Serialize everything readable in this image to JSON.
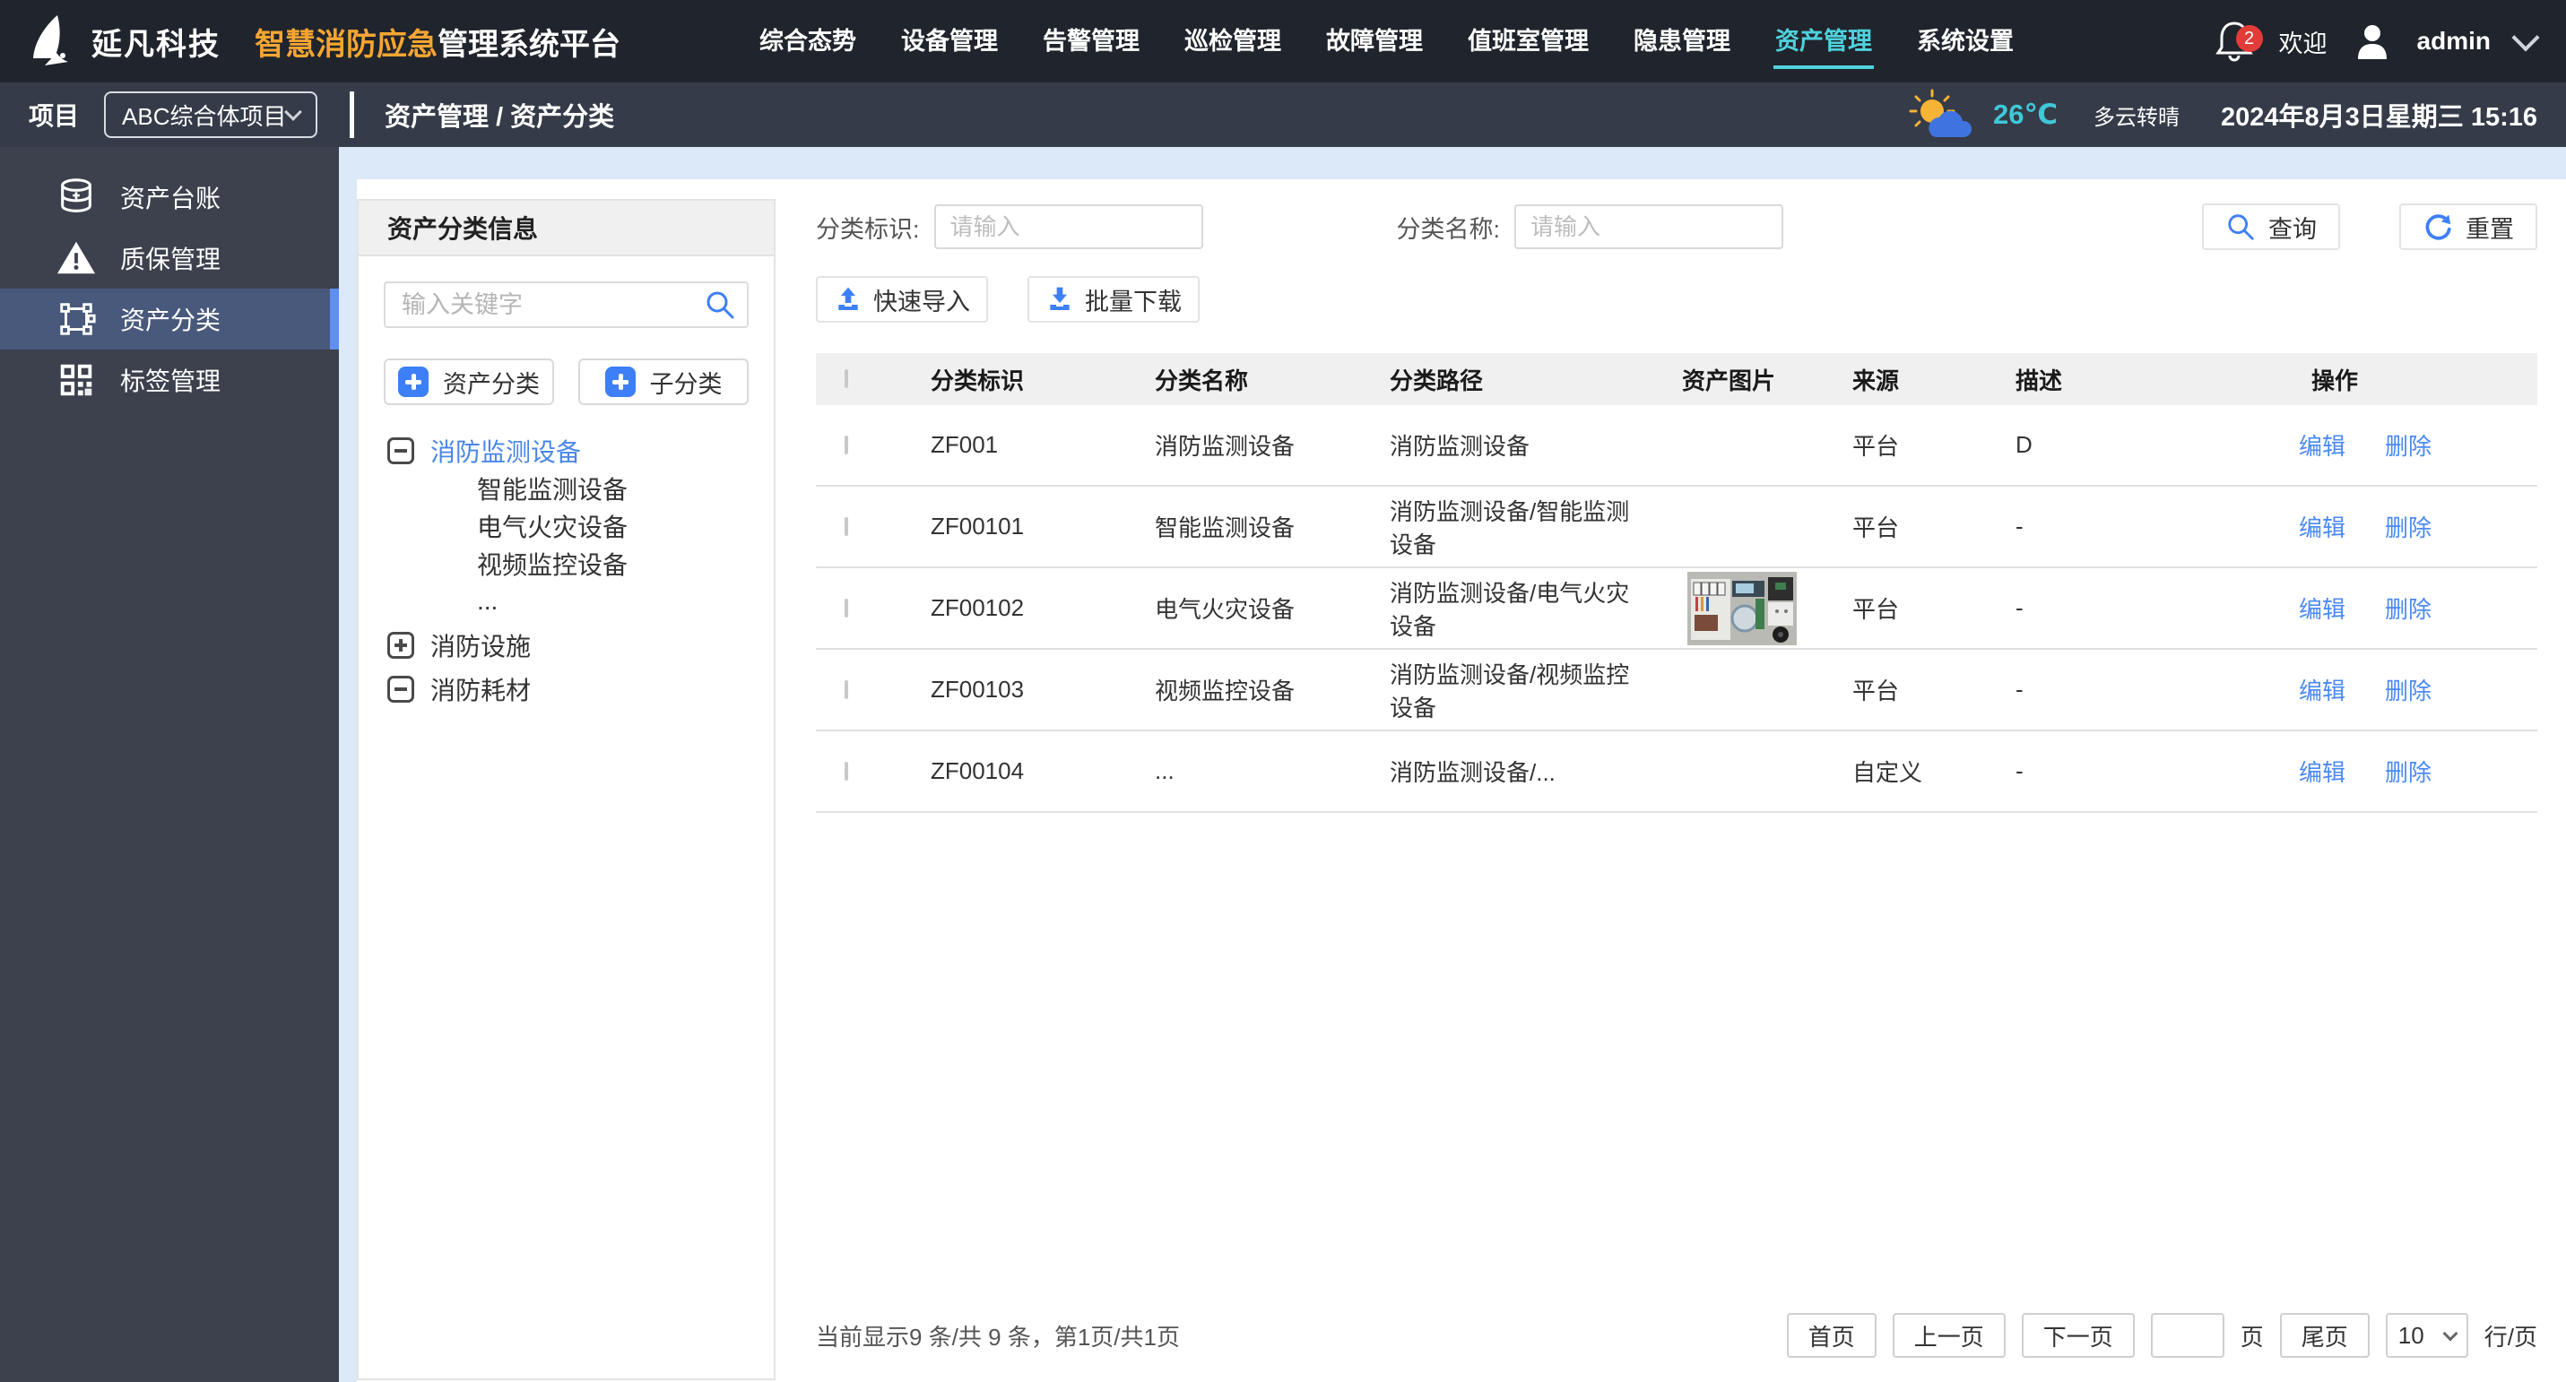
{
  "colors": {
    "accent_blue": "#3D7FF7",
    "link_blue": "#4A8AF4",
    "active_cyan": "#4FD2DD",
    "brand_orange": "#F5A632",
    "badge_red": "#E23C39",
    "sidebar_active_indicator": "#5F8FF0",
    "content_bg": "#DCE9F8",
    "temp_cyan": "#3FC8D8"
  },
  "topbar": {
    "company": "延凡科技",
    "title_highlight": "智慧消防应急",
    "title_rest": "管理系统平台",
    "nav": [
      {
        "label": "综合态势"
      },
      {
        "label": "设备管理"
      },
      {
        "label": "告警管理"
      },
      {
        "label": "巡检管理"
      },
      {
        "label": "故障管理"
      },
      {
        "label": "值班室管理"
      },
      {
        "label": "隐患管理"
      },
      {
        "label": "资产管理",
        "active": true
      },
      {
        "label": "系统设置"
      }
    ],
    "notification_count": "2",
    "welcome": "欢迎",
    "username": "admin"
  },
  "subbar": {
    "project_label": "项目",
    "project_value": "ABC综合体项目",
    "breadcrumb": "资产管理 / 资产分类",
    "weather": {
      "temp": "26℃",
      "condition": "多云转晴",
      "datetime": "2024年8月3日星期三 15:16"
    }
  },
  "sidebar": {
    "items": [
      {
        "label": "资产台账"
      },
      {
        "label": "质保管理"
      },
      {
        "label": "资产分类",
        "active": true
      },
      {
        "label": "标签管理"
      }
    ]
  },
  "tree_panel": {
    "title": "资产分类信息",
    "search_placeholder": "输入关键字",
    "add_category_label": "资产分类",
    "add_subcategory_label": "子分类",
    "root_label": "消防监测设备",
    "children": [
      "智能监测设备",
      "电气火灾设备",
      "视频监控设备",
      "..."
    ],
    "sibling1_label": "消防设施",
    "sibling2_label": "消防耗材"
  },
  "main": {
    "filters": [
      {
        "label": "分类标识:",
        "placeholder": "请输入"
      },
      {
        "label": "分类名称:",
        "placeholder": "请输入"
      }
    ],
    "search_button": "查询",
    "reset_button": "重置",
    "import_button": "快速导入",
    "download_button": "批量下载",
    "table": {
      "headers": [
        "分类标识",
        "分类名称",
        "分类路径",
        "资产图片",
        "来源",
        "描述",
        "操作"
      ],
      "edit_label": "编辑",
      "delete_label": "删除",
      "rows": [
        {
          "id": "ZF001",
          "name": "消防监测设备",
          "path": "消防监测设备",
          "has_image": false,
          "source": "平台",
          "desc": "D"
        },
        {
          "id": "ZF00101",
          "name": "智能监测设备",
          "path": "消防监测设备/智能监测设备",
          "has_image": false,
          "source": "平台",
          "desc": "-"
        },
        {
          "id": "ZF00102",
          "name": "电气火灾设备",
          "path": "消防监测设备/电气火灾设备",
          "has_image": true,
          "source": "平台",
          "desc": "-"
        },
        {
          "id": "ZF00103",
          "name": "视频监控设备",
          "path": "消防监测设备/视频监控设备",
          "has_image": false,
          "source": "平台",
          "desc": "-"
        },
        {
          "id": "ZF00104",
          "name": "...",
          "path": "消防监测设备/...",
          "has_image": false,
          "source": "自定义",
          "desc": "-"
        }
      ]
    },
    "pagination": {
      "info": "当前显示9 条/共 9 条，第1页/共1页",
      "first": "首页",
      "prev": "上一页",
      "next": "下一页",
      "page_suffix": "页",
      "last": "尾页",
      "page_size": "10",
      "rows_per_page": "行/页"
    }
  }
}
